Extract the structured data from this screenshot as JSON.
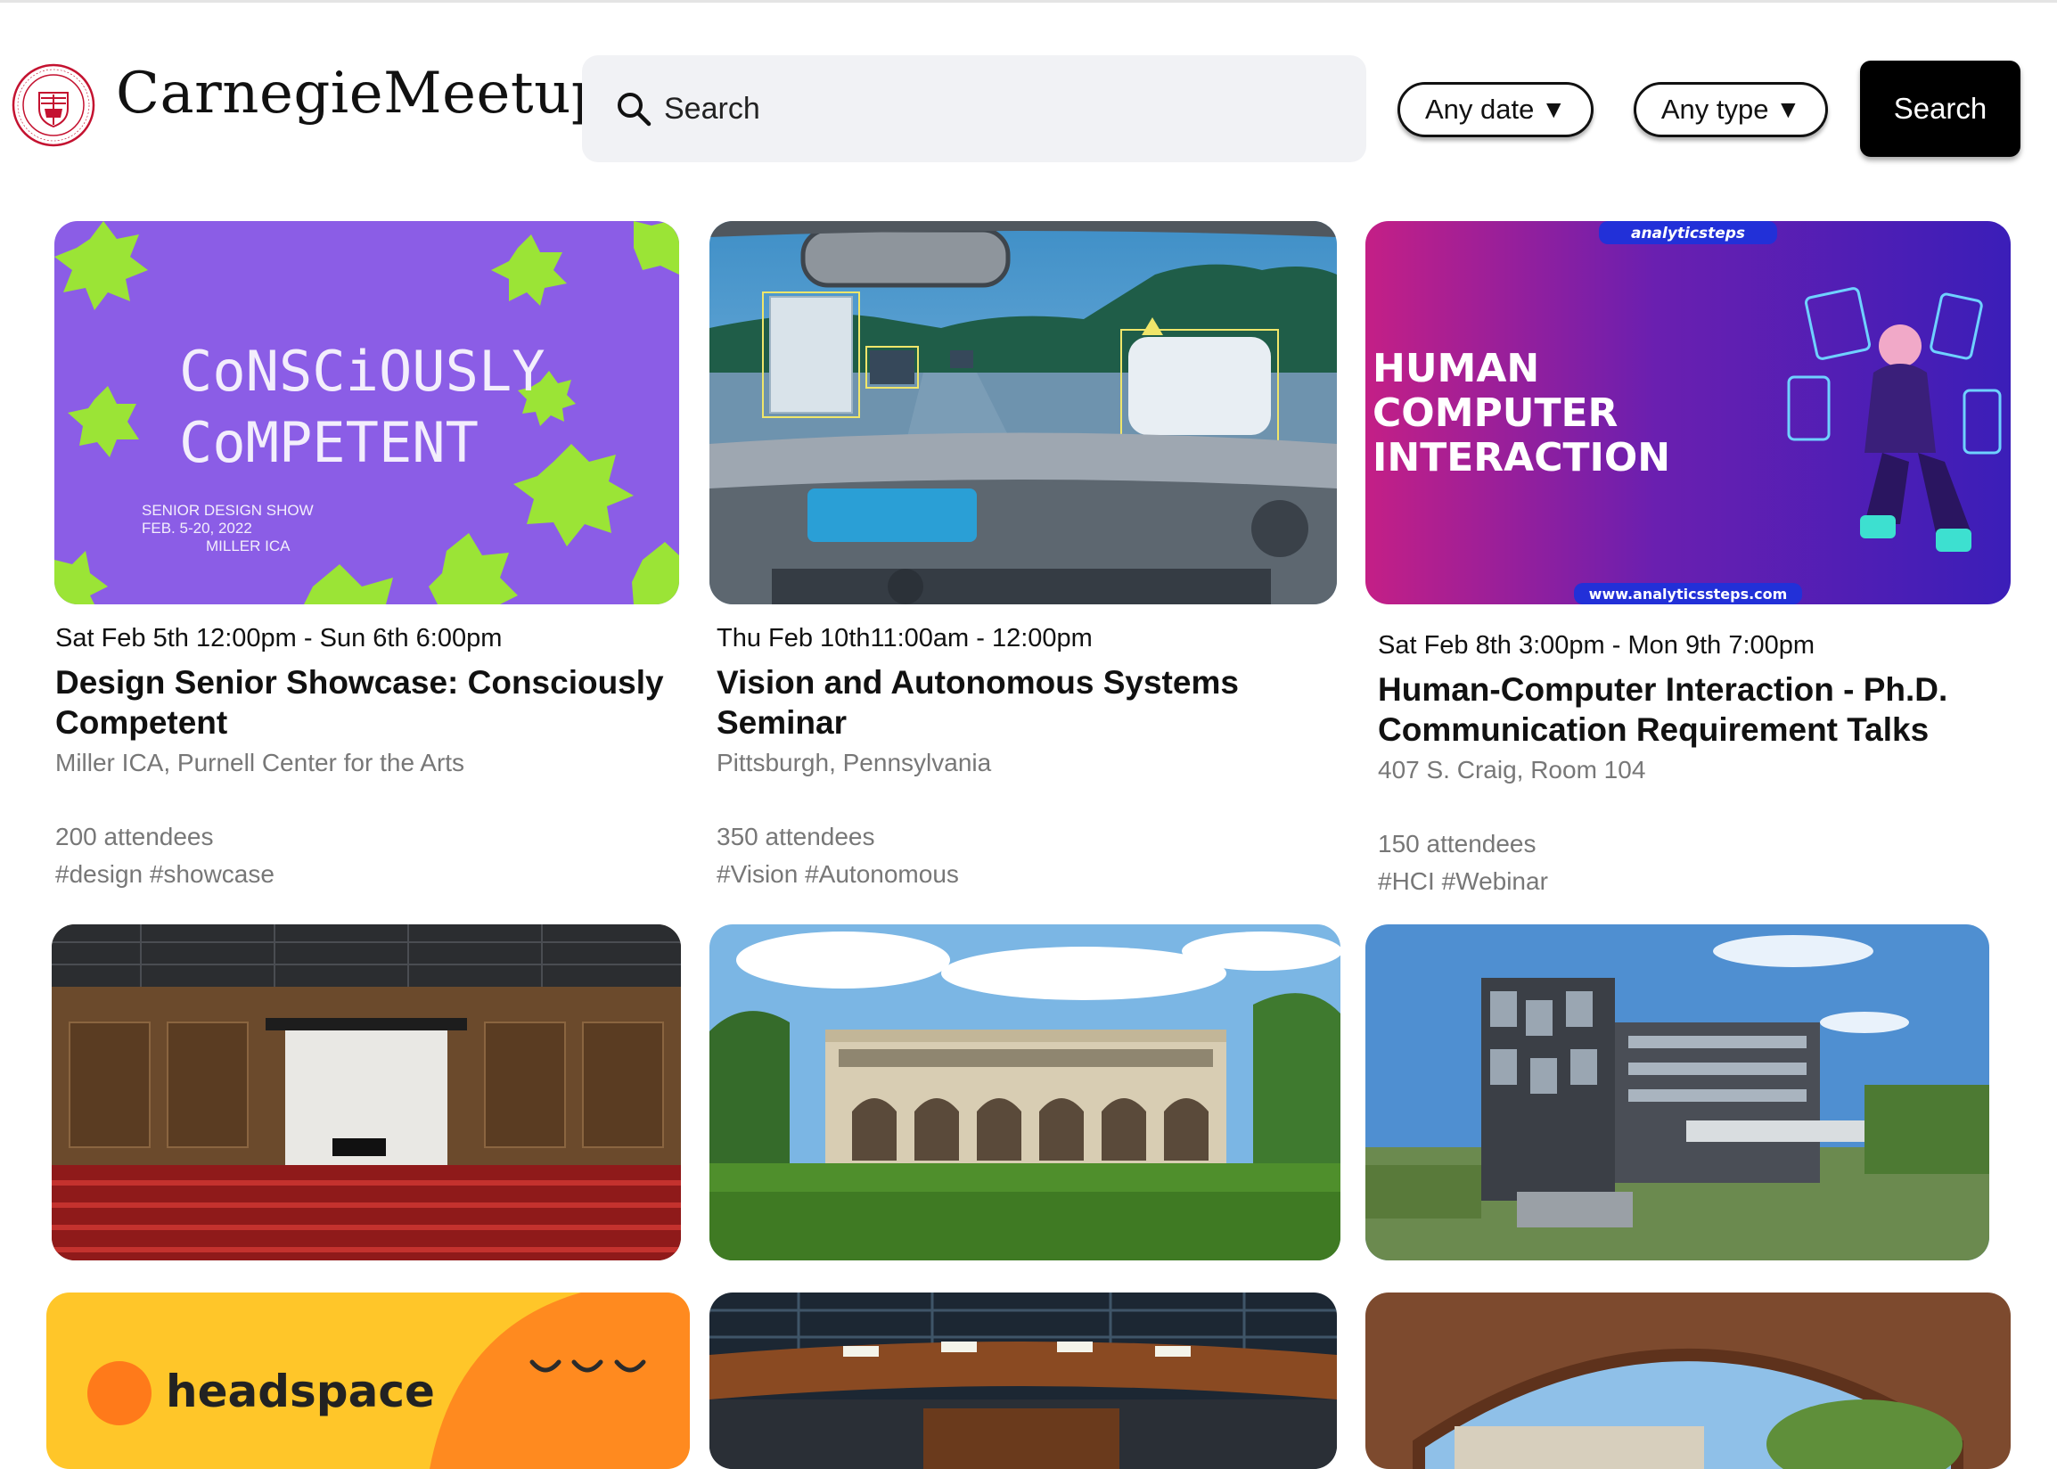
{
  "header": {
    "brand": "CarnegieMeetup",
    "search_placeholder": "Search",
    "date_filter": "Any date",
    "type_filter": "Any type",
    "search_button": "Search"
  },
  "events": [
    {
      "date": "Sat Feb 5th 12:00pm - Sun 6th 6:00pm",
      "title": "Design Senior Showcase: Consciously Competent",
      "location": "Miller ICA, Purnell Center for the Arts",
      "attendees": "200 attendees",
      "tags": "#design #showcase",
      "poster": {
        "line1": "CoNSCiOUSLY",
        "line2": "CoMPETENT",
        "caption1": "SENIOR DESIGN SHOW",
        "caption2": "FEB. 5-20, 2022",
        "caption3": "MILLER ICA"
      }
    },
    {
      "date": "Thu Feb 10th11:00am - 12:00pm",
      "title": "Vision and Autonomous Systems Seminar",
      "location": "Pittsburgh, Pennsylvania",
      "attendees": "350 attendees",
      "tags": "#Vision #Autonomous"
    },
    {
      "date": "Sat Feb 8th 3:00pm - Mon 9th 7:00pm",
      "title": "Human-Computer Interaction - Ph.D. Communication Requirement Talks",
      "location": "407 S. Craig, Room 104",
      "attendees": "150 attendees",
      "tags": "#HCI #Webinar",
      "poster": {
        "brand": "analyticsteps",
        "line1": "HUMAN",
        "line2": "COMPUTER",
        "line3": "INTERACTION",
        "url": "www.analyticssteps.com"
      }
    }
  ],
  "row3": {
    "headspace": "headspace"
  }
}
